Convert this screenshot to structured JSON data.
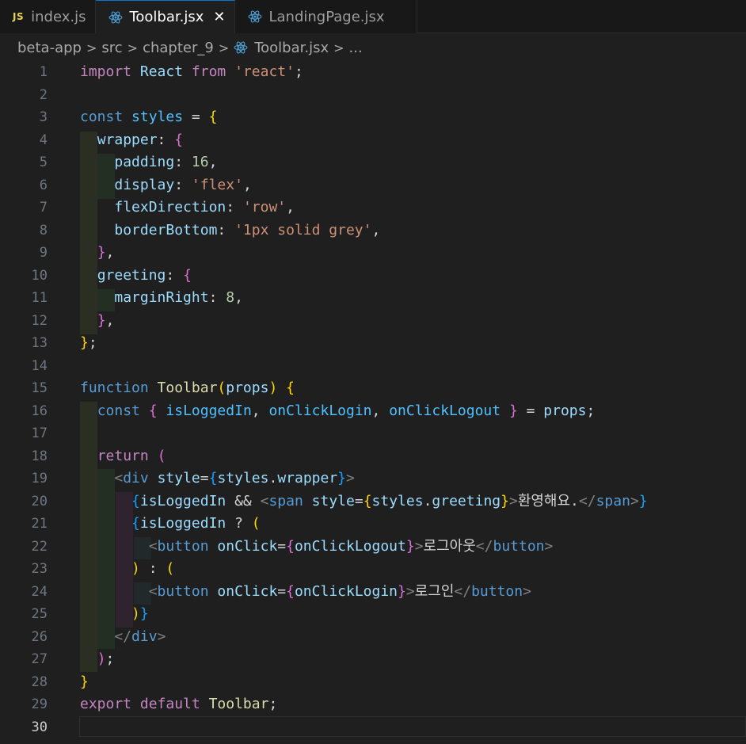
{
  "tabs": [
    {
      "label": "index.js",
      "icon": "js-file-icon",
      "icon_text": "JS",
      "active": false
    },
    {
      "label": "Toolbar.jsx",
      "icon": "react-icon",
      "active": true,
      "close": "✕"
    },
    {
      "label": "LandingPage.jsx",
      "icon": "react-icon",
      "active": false
    }
  ],
  "breadcrumb": {
    "items": [
      "beta-app",
      "src",
      "chapter_9",
      "Toolbar.jsx",
      "..."
    ],
    "separator": ">"
  },
  "editor": {
    "current_line": 30,
    "colors": {
      "keyword_blue": "#569cd6",
      "keyword_purple": "#c586c0",
      "variable": "#9cdcfe",
      "constant": "#4fc1ff",
      "function": "#dcdcaa",
      "string": "#ce9178",
      "number": "#b5cea8",
      "bracket_1": "#ffd700",
      "bracket_2": "#da70d6",
      "bracket_3": "#179fff"
    },
    "lines": [
      {
        "n": "1",
        "tokens": [
          [
            "kw-p",
            "import"
          ],
          [
            "txt",
            " "
          ],
          [
            "var",
            "React"
          ],
          [
            "txt",
            " "
          ],
          [
            "kw-p",
            "from"
          ],
          [
            "txt",
            " "
          ],
          [
            "str",
            "'react'"
          ],
          [
            "pun",
            ";"
          ]
        ]
      },
      {
        "n": "2",
        "tokens": []
      },
      {
        "n": "3",
        "tokens": [
          [
            "kw-b",
            "const"
          ],
          [
            "txt",
            " "
          ],
          [
            "cst",
            "styles"
          ],
          [
            "pun",
            " = "
          ],
          [
            "br1",
            "{"
          ]
        ]
      },
      {
        "n": "4",
        "tokens": [
          [
            "txt",
            "  "
          ],
          [
            "var",
            "wrapper"
          ],
          [
            "pun",
            ": "
          ],
          [
            "br2",
            "{"
          ]
        ]
      },
      {
        "n": "5",
        "tokens": [
          [
            "txt",
            "    "
          ],
          [
            "var",
            "padding"
          ],
          [
            "pun",
            ": "
          ],
          [
            "num",
            "16"
          ],
          [
            "pun",
            ","
          ]
        ]
      },
      {
        "n": "6",
        "tokens": [
          [
            "txt",
            "    "
          ],
          [
            "var",
            "display"
          ],
          [
            "pun",
            ": "
          ],
          [
            "str",
            "'flex'"
          ],
          [
            "pun",
            ","
          ]
        ]
      },
      {
        "n": "7",
        "tokens": [
          [
            "txt",
            "    "
          ],
          [
            "var",
            "flexDirection"
          ],
          [
            "pun",
            ": "
          ],
          [
            "str",
            "'row'"
          ],
          [
            "pun",
            ","
          ]
        ]
      },
      {
        "n": "8",
        "tokens": [
          [
            "txt",
            "    "
          ],
          [
            "var",
            "borderBottom"
          ],
          [
            "pun",
            ": "
          ],
          [
            "str",
            "'1px solid grey'"
          ],
          [
            "pun",
            ","
          ]
        ]
      },
      {
        "n": "9",
        "tokens": [
          [
            "txt",
            "  "
          ],
          [
            "br2",
            "}"
          ],
          [
            "pun",
            ","
          ]
        ]
      },
      {
        "n": "10",
        "tokens": [
          [
            "txt",
            "  "
          ],
          [
            "var",
            "greeting"
          ],
          [
            "pun",
            ": "
          ],
          [
            "br2",
            "{"
          ]
        ]
      },
      {
        "n": "11",
        "tokens": [
          [
            "txt",
            "    "
          ],
          [
            "var",
            "marginRight"
          ],
          [
            "pun",
            ": "
          ],
          [
            "num",
            "8"
          ],
          [
            "pun",
            ","
          ]
        ]
      },
      {
        "n": "12",
        "tokens": [
          [
            "txt",
            "  "
          ],
          [
            "br2",
            "}"
          ],
          [
            "pun",
            ","
          ]
        ]
      },
      {
        "n": "13",
        "tokens": [
          [
            "br1",
            "}"
          ],
          [
            "pun",
            ";"
          ]
        ]
      },
      {
        "n": "14",
        "tokens": []
      },
      {
        "n": "15",
        "tokens": [
          [
            "kw-b",
            "function"
          ],
          [
            "txt",
            " "
          ],
          [
            "fn",
            "Toolbar"
          ],
          [
            "br1",
            "("
          ],
          [
            "var",
            "props"
          ],
          [
            "br1",
            ")"
          ],
          [
            "txt",
            " "
          ],
          [
            "br1",
            "{"
          ]
        ]
      },
      {
        "n": "16",
        "tokens": [
          [
            "txt",
            "  "
          ],
          [
            "kw-b",
            "const"
          ],
          [
            "txt",
            " "
          ],
          [
            "br2",
            "{"
          ],
          [
            "txt",
            " "
          ],
          [
            "cst",
            "isLoggedIn"
          ],
          [
            "pun",
            ", "
          ],
          [
            "cst",
            "onClickLogin"
          ],
          [
            "pun",
            ", "
          ],
          [
            "cst",
            "onClickLogout"
          ],
          [
            "txt",
            " "
          ],
          [
            "br2",
            "}"
          ],
          [
            "pun",
            " = "
          ],
          [
            "var",
            "props"
          ],
          [
            "pun",
            ";"
          ]
        ]
      },
      {
        "n": "17",
        "tokens": []
      },
      {
        "n": "18",
        "tokens": [
          [
            "txt",
            "  "
          ],
          [
            "kw-p",
            "return"
          ],
          [
            "txt",
            " "
          ],
          [
            "br2",
            "("
          ]
        ]
      },
      {
        "n": "19",
        "tokens": [
          [
            "txt",
            "    "
          ],
          [
            "tagb",
            "<"
          ],
          [
            "tag",
            "div"
          ],
          [
            "txt",
            " "
          ],
          [
            "attr",
            "style"
          ],
          [
            "pun",
            "="
          ],
          [
            "br3",
            "{"
          ],
          [
            "var",
            "styles"
          ],
          [
            "pun",
            "."
          ],
          [
            "var",
            "wrapper"
          ],
          [
            "br3",
            "}"
          ],
          [
            "tagb",
            ">"
          ]
        ]
      },
      {
        "n": "20",
        "tokens": [
          [
            "txt",
            "      "
          ],
          [
            "br3",
            "{"
          ],
          [
            "var",
            "isLoggedIn"
          ],
          [
            "txt",
            " "
          ],
          [
            "pun",
            "&&"
          ],
          [
            "txt",
            " "
          ],
          [
            "tagb",
            "<"
          ],
          [
            "tag",
            "span"
          ],
          [
            "txt",
            " "
          ],
          [
            "attr",
            "style"
          ],
          [
            "pun",
            "="
          ],
          [
            "br1",
            "{"
          ],
          [
            "var",
            "styles"
          ],
          [
            "pun",
            "."
          ],
          [
            "var",
            "greeting"
          ],
          [
            "br1",
            "}"
          ],
          [
            "tagb",
            ">"
          ],
          [
            "txt",
            "환영해요."
          ],
          [
            "tagb",
            "</"
          ],
          [
            "tag",
            "span"
          ],
          [
            "tagb",
            ">"
          ],
          [
            "br3",
            "}"
          ]
        ]
      },
      {
        "n": "21",
        "tokens": [
          [
            "txt",
            "      "
          ],
          [
            "br3",
            "{"
          ],
          [
            "var",
            "isLoggedIn"
          ],
          [
            "txt",
            " "
          ],
          [
            "pun",
            "?"
          ],
          [
            "txt",
            " "
          ],
          [
            "br1",
            "("
          ]
        ]
      },
      {
        "n": "22",
        "tokens": [
          [
            "txt",
            "        "
          ],
          [
            "tagb",
            "<"
          ],
          [
            "tag",
            "button"
          ],
          [
            "txt",
            " "
          ],
          [
            "attr",
            "onClick"
          ],
          [
            "pun",
            "="
          ],
          [
            "br2",
            "{"
          ],
          [
            "var",
            "onClickLogout"
          ],
          [
            "br2",
            "}"
          ],
          [
            "tagb",
            ">"
          ],
          [
            "txt",
            "로그아웃"
          ],
          [
            "tagb",
            "</"
          ],
          [
            "tag",
            "button"
          ],
          [
            "tagb",
            ">"
          ]
        ]
      },
      {
        "n": "23",
        "tokens": [
          [
            "txt",
            "      "
          ],
          [
            "br1",
            ")"
          ],
          [
            "txt",
            " "
          ],
          [
            "pun",
            ":"
          ],
          [
            "txt",
            " "
          ],
          [
            "br1",
            "("
          ]
        ]
      },
      {
        "n": "24",
        "tokens": [
          [
            "txt",
            "        "
          ],
          [
            "tagb",
            "<"
          ],
          [
            "tag",
            "button"
          ],
          [
            "txt",
            " "
          ],
          [
            "attr",
            "onClick"
          ],
          [
            "pun",
            "="
          ],
          [
            "br2",
            "{"
          ],
          [
            "var",
            "onClickLogin"
          ],
          [
            "br2",
            "}"
          ],
          [
            "tagb",
            ">"
          ],
          [
            "txt",
            "로그인"
          ],
          [
            "tagb",
            "</"
          ],
          [
            "tag",
            "button"
          ],
          [
            "tagb",
            ">"
          ]
        ]
      },
      {
        "n": "25",
        "tokens": [
          [
            "txt",
            "      "
          ],
          [
            "br1",
            ")"
          ],
          [
            "br3",
            "}"
          ]
        ]
      },
      {
        "n": "26",
        "tokens": [
          [
            "txt",
            "    "
          ],
          [
            "tagb",
            "</"
          ],
          [
            "tag",
            "div"
          ],
          [
            "tagb",
            ">"
          ]
        ]
      },
      {
        "n": "27",
        "tokens": [
          [
            "txt",
            "  "
          ],
          [
            "br2",
            ")"
          ],
          [
            "pun",
            ";"
          ]
        ]
      },
      {
        "n": "28",
        "tokens": [
          [
            "br1",
            "}"
          ]
        ]
      },
      {
        "n": "29",
        "tokens": [
          [
            "kw-p",
            "export"
          ],
          [
            "txt",
            " "
          ],
          [
            "kw-p",
            "default"
          ],
          [
            "txt",
            " "
          ],
          [
            "fn",
            "Toolbar"
          ],
          [
            "pun",
            ";"
          ]
        ]
      },
      {
        "n": "30",
        "tokens": []
      }
    ]
  }
}
